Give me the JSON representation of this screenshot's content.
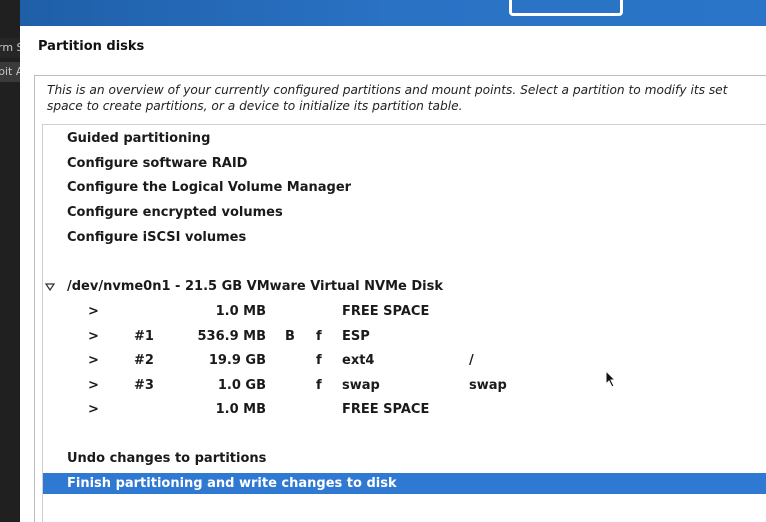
{
  "left_strip": {
    "fragment_1": "rm S",
    "fragment_2": "bit A"
  },
  "page_title": "Partition disks",
  "description": [
    "This is an overview of your currently configured partitions and mount points. Select a partition to modify its set",
    "space to create partitions, or a device to initialize its partition table."
  ],
  "actions": [
    "Guided partitioning",
    "Configure software RAID",
    "Configure the Logical Volume Manager",
    "Configure encrypted volumes",
    "Configure iSCSI volumes"
  ],
  "disk": {
    "label": "/dev/nvme0n1 - 21.5 GB VMware Virtual NVMe Disk",
    "expand_icon": "triangle-down-icon",
    "partitions": [
      {
        "arrow": ">",
        "num": "",
        "size": "1.0 MB",
        "boot": "",
        "fmt": "",
        "type": "FREE SPACE",
        "mount": ""
      },
      {
        "arrow": ">",
        "num": "#1",
        "size": "536.9 MB",
        "boot": "B",
        "fmt": "f",
        "type": "ESP",
        "mount": ""
      },
      {
        "arrow": ">",
        "num": "#2",
        "size": "19.9 GB",
        "boot": "",
        "fmt": "f",
        "type": "ext4",
        "mount": "/"
      },
      {
        "arrow": ">",
        "num": "#3",
        "size": "1.0 GB",
        "boot": "",
        "fmt": "f",
        "type": "swap",
        "mount": "swap"
      },
      {
        "arrow": ">",
        "num": "",
        "size": "1.0 MB",
        "boot": "",
        "fmt": "",
        "type": "FREE SPACE",
        "mount": ""
      }
    ]
  },
  "undo_label": "Undo changes to partitions",
  "finish_label": "Finish partitioning and write changes to disk",
  "colors": {
    "selection": "#2f79d2",
    "banner": "#2a72c4"
  }
}
